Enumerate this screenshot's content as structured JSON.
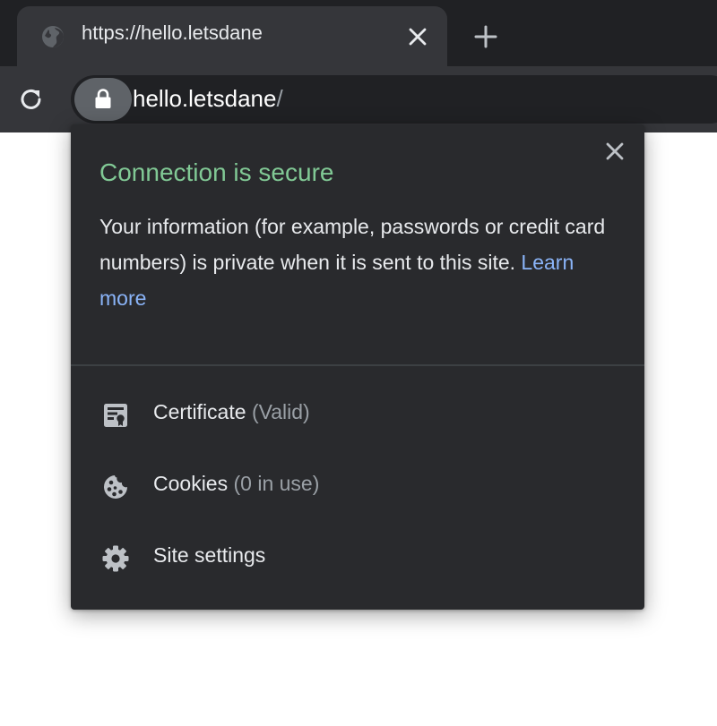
{
  "tab": {
    "title": "https://hello.letsdane",
    "favicon": "globe-icon"
  },
  "toolbar": {
    "url_host": "hello.letsdane",
    "url_path": "/"
  },
  "popup": {
    "title": "Connection is secure",
    "description": "Your information (for example, passwords or credit card numbers) is private when it is sent to this site.",
    "learn_more": "Learn more",
    "items": [
      {
        "label": "Certificate",
        "detail": "(Valid)",
        "icon": "certificate-icon"
      },
      {
        "label": "Cookies",
        "detail": "(0 in use)",
        "icon": "cookie-icon"
      },
      {
        "label": "Site settings",
        "detail": "",
        "icon": "gear-icon"
      }
    ]
  },
  "colors": {
    "secure_green": "#81c995",
    "link_blue": "#8ab4f8",
    "popup_bg": "#292a2d",
    "tabstrip_bg": "#202124",
    "toolbar_bg": "#35363a"
  }
}
